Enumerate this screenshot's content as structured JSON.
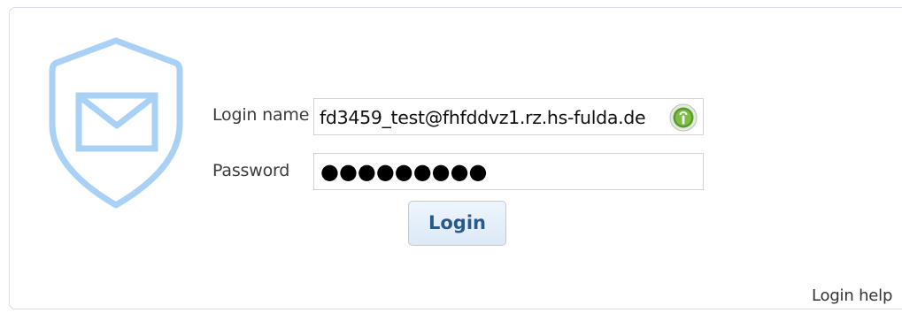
{
  "login_form": {
    "login_name_label": "Login name",
    "login_name_value": "fd3459_test@fhfddvz1.rz.hs-fulda.de",
    "password_label": "Password",
    "password_masked": "●●●●●●●●●",
    "login_button_label": "Login",
    "help_link_label": "Login help"
  },
  "icons": {
    "shield": "shield-mail-icon",
    "field_badge": "keepass-icon"
  },
  "colors": {
    "shield": "#a9d0f5",
    "button_text": "#2a5a8c",
    "badge_green": "#5a9a2e"
  }
}
